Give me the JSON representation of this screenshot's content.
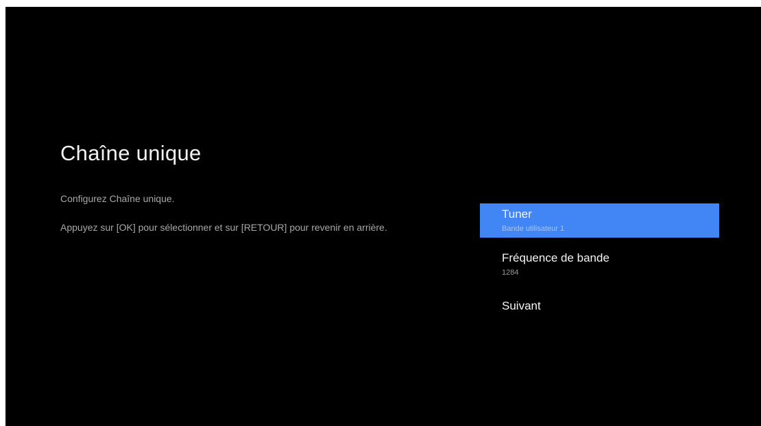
{
  "colors": {
    "accent": "#4285f4",
    "background": "#000000"
  },
  "header": {
    "title": "Chaîne unique"
  },
  "description": {
    "line1": "Configurez Chaîne unique.",
    "line2": "Appuyez sur [OK] pour sélectionner et sur [RETOUR] pour revenir en arrière."
  },
  "menu": {
    "items": [
      {
        "label": "Tuner",
        "value": "Bande utilisateur 1",
        "focused": true
      },
      {
        "label": "Fréquence de bande",
        "value": "1284",
        "focused": false
      },
      {
        "label": "Suivant",
        "focused": false
      }
    ]
  }
}
